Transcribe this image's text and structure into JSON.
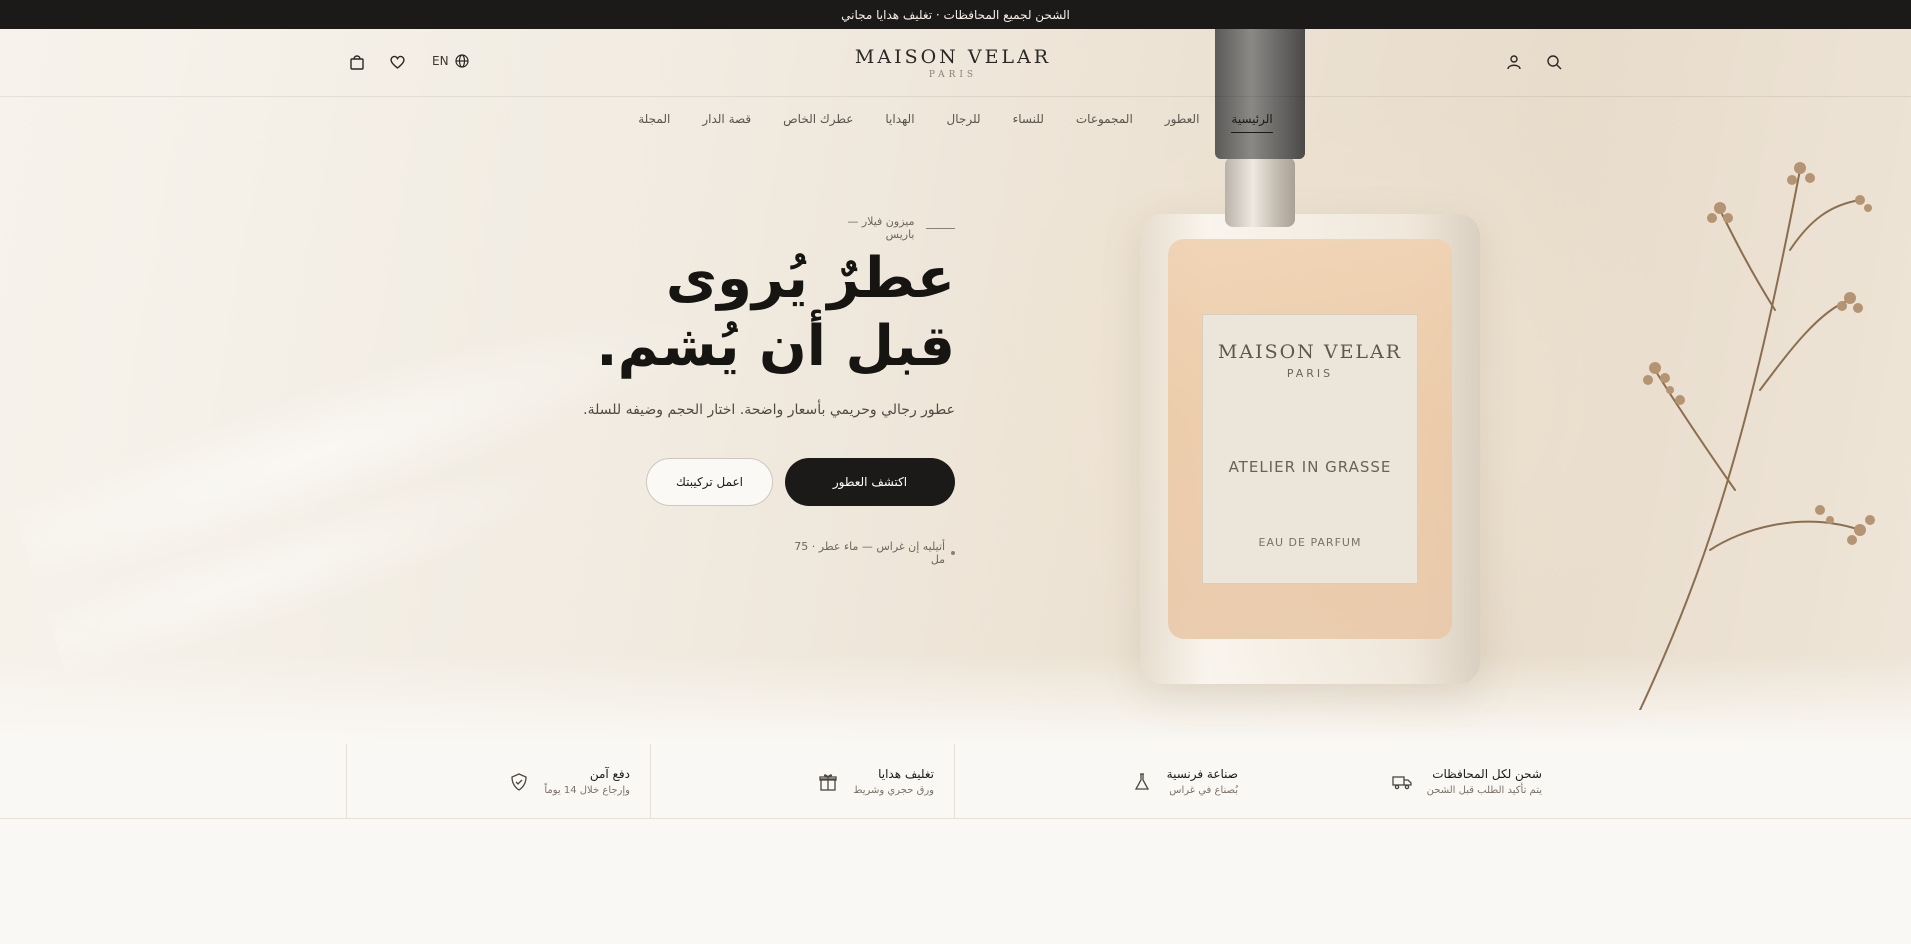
{
  "announcement": "الشحن لجميع المحافظات · تغليف هدايا مجاني",
  "header": {
    "logo_main": "MAISON VELAR",
    "logo_sub": "PARIS",
    "lang_label": "EN"
  },
  "nav": {
    "items": [
      {
        "label": "الرئيسية"
      },
      {
        "label": "العطور"
      },
      {
        "label": "المجموعات"
      },
      {
        "label": "للنساء"
      },
      {
        "label": "للرجال"
      },
      {
        "label": "الهدايا"
      },
      {
        "label": "عطرك الخاص"
      },
      {
        "label": "قصة الدار"
      },
      {
        "label": "المجلة"
      }
    ]
  },
  "hero": {
    "eyebrow": "ميزون فيلار — باريس",
    "headline_line1": "عطرٌ يُروى",
    "headline_line2": "قبل أن يُشم.",
    "subcopy": "عطور رجالي وحريمي بأسعار واضحة. اختار الحجم وضيفه للسلة.",
    "primary_cta": "اكتشف العطور",
    "secondary_cta": "اعمل تركيبتك",
    "product_note": "أتيليه إن غراس — ماء عطر · 75 مل"
  },
  "bottle_label": {
    "brand": "MAISON VELAR",
    "city": "PARIS",
    "collection": "ATELIER IN GRASSE",
    "type": "EAU DE PARFUM"
  },
  "features": [
    {
      "title": "شحن لكل المحافظات",
      "sub": "يتم تأكيد الطلب قبل الشحن",
      "icon": "truck-icon"
    },
    {
      "title": "صناعة فرنسية",
      "sub": "بُصناع في غراس",
      "icon": "flask-icon"
    },
    {
      "title": "تغليف هدايا",
      "sub": "ورق حجري وشريط",
      "icon": "gift-icon"
    },
    {
      "title": "دفع آمن",
      "sub": "وإرجاع خلال 14 يوماً",
      "icon": "shield-icon"
    }
  ],
  "colors": {
    "ink": "#1b1a19",
    "cream": "#faf8f4",
    "amber": "#ecc9a5"
  }
}
